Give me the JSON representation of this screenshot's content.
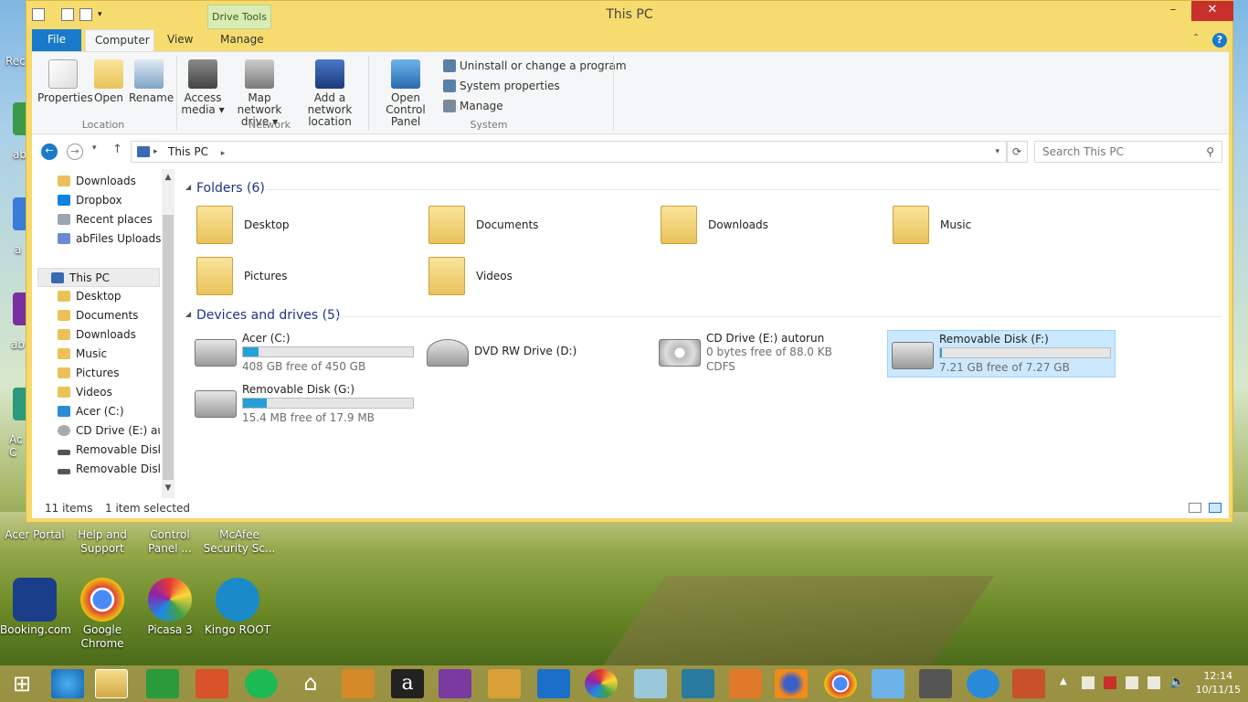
{
  "window": {
    "title": "This PC",
    "contextual_tab": "Drive Tools",
    "controls": {
      "minimize": "–",
      "maximize": "□",
      "close": "✕"
    }
  },
  "ribbon": {
    "tabs": [
      "File",
      "Computer",
      "View",
      "Manage"
    ],
    "selected_tab": "Computer",
    "location_group": {
      "label": "Location",
      "buttons": [
        "Properties",
        "Open",
        "Rename"
      ]
    },
    "network_group": {
      "label": "Network",
      "buttons": [
        {
          "line1": "Access",
          "line2": "media ▾"
        },
        {
          "line1": "Map network",
          "line2": "drive ▾"
        },
        {
          "line1": "Add a network",
          "line2": "location"
        }
      ]
    },
    "system_group": {
      "label": "System",
      "open_control_panel": {
        "line1": "Open Control",
        "line2": "Panel"
      },
      "small": [
        "Uninstall or change a program",
        "System properties",
        "Manage"
      ]
    }
  },
  "address": {
    "path": "This PC",
    "search_placeholder": "Search This PC"
  },
  "nav_pane": {
    "top_items": [
      "Downloads",
      "Dropbox",
      "Recent places",
      "abFiles Uploads"
    ],
    "this_pc": "This PC",
    "this_pc_items": [
      "Desktop",
      "Documents",
      "Downloads",
      "Music",
      "Pictures",
      "Videos",
      "Acer (C:)",
      "CD Drive (E:) autorun",
      "Removable Disk (F:)",
      "Removable Disk (G:)"
    ]
  },
  "folders_section": {
    "heading": "Folders (6)",
    "items": [
      "Desktop",
      "Documents",
      "Downloads",
      "Music",
      "Pictures",
      "Videos"
    ]
  },
  "devices_section": {
    "heading": "Devices and drives (5)",
    "drives": [
      {
        "name": "Acer (C:)",
        "detail": "408 GB free of 450 GB",
        "used_fraction": 0.093
      },
      {
        "name": "DVD RW Drive (D:)",
        "detail": ""
      },
      {
        "name": "CD Drive (E:) autorun",
        "detail": "0 bytes free of 88.0 KB",
        "detail2": "CDFS"
      },
      {
        "name": "Removable Disk (F:)",
        "detail": "7.21 GB free of 7.27 GB",
        "used_fraction": 0.01
      },
      {
        "name": "Removable Disk (G:)",
        "detail": "15.4 MB free of 17.9 MB",
        "used_fraction": 0.14
      }
    ]
  },
  "status_bar": {
    "items_count": "11 items",
    "selection": "1 item selected"
  },
  "desktop": {
    "left_labels": [
      "Rec",
      "ab",
      "a",
      "ab",
      "Ac C"
    ],
    "row1": [
      "Acer Portal",
      "Help and Support",
      "Control Panel ...",
      "McAfee Security Sc..."
    ],
    "row2": [
      "Booking.com",
      "Google Chrome",
      "Picasa 3",
      "Kingo ROOT"
    ]
  },
  "taskbar": {
    "time": "12:14",
    "date": "10/11/15"
  },
  "colors": {
    "accent": "#1979ca",
    "title_bar": "#f6dc6e",
    "progress": "#26a0da",
    "section_heading": "#1e3287",
    "selection": "#cce8ff"
  }
}
